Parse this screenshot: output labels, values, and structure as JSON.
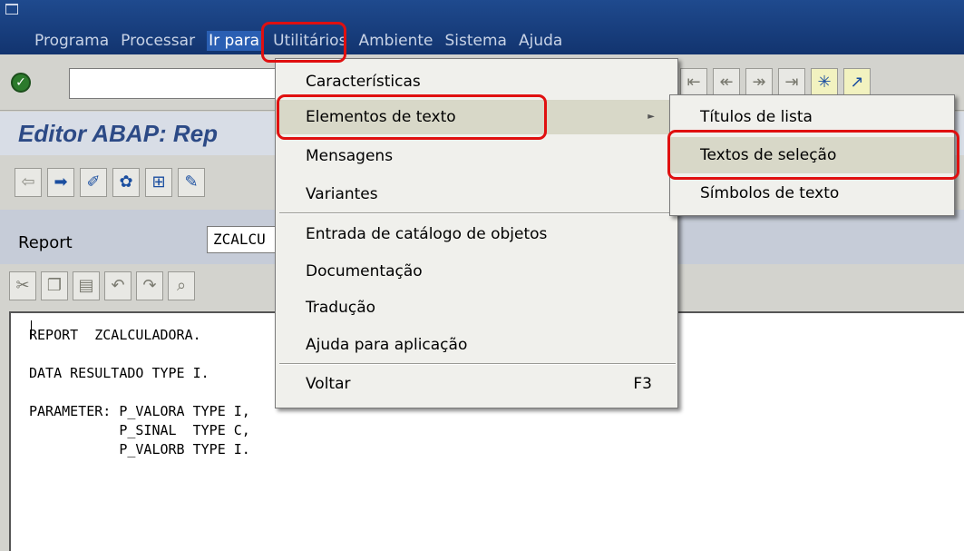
{
  "menubar": {
    "items": [
      "Programa",
      "Processar",
      "Ir para",
      "Utilitários",
      "Ambiente",
      "Sistema",
      "Ajuda"
    ],
    "active_index": 2
  },
  "toolbar": {
    "ok_icon": "checkmark-icon"
  },
  "title": "Editor ABAP: Rep",
  "report": {
    "label": "Report",
    "value": "ZCALCU"
  },
  "editor": {
    "code": "REPORT  ZCALCULADORA.\n\nDATA RESULTADO TYPE I.\n\nPARAMETER: P_VALORA TYPE I,\n           P_SINAL  TYPE C,\n           P_VALORB TYPE I."
  },
  "dropdown": {
    "items": [
      {
        "label": "Características"
      },
      {
        "label": "Elementos de texto",
        "has_submenu": true
      },
      {
        "label": "Mensagens"
      },
      {
        "label": "Variantes"
      },
      {
        "label": "Entrada de catálogo de objetos"
      },
      {
        "label": "Documentação"
      },
      {
        "label": "Tradução"
      },
      {
        "label": "Ajuda para aplicação"
      },
      {
        "label": "Voltar",
        "shortcut": "F3"
      }
    ]
  },
  "submenu": {
    "items": [
      {
        "label": "Títulos de lista"
      },
      {
        "label": "Textos de seleção"
      },
      {
        "label": "Símbolos de texto"
      }
    ]
  },
  "colors": {
    "menubar": "#1f4a8e",
    "highlight_outline": "#e01010"
  }
}
